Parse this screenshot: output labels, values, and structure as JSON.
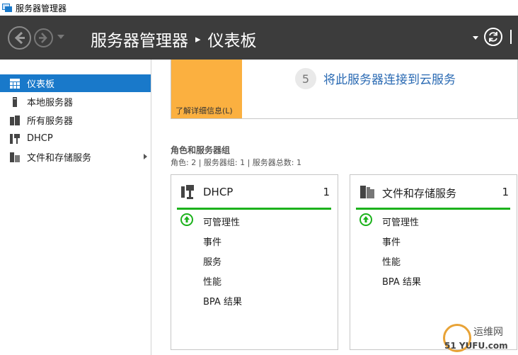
{
  "window": {
    "title": "服务器管理器"
  },
  "header": {
    "breadcrumb_root": "服务器管理器",
    "breadcrumb_separator": "▸",
    "breadcrumb_current": "仪表板"
  },
  "sidebar": {
    "items": [
      {
        "label": "仪表板",
        "icon": "dashboard-icon",
        "active": true
      },
      {
        "label": "本地服务器",
        "icon": "server-icon"
      },
      {
        "label": "所有服务器",
        "icon": "servers-icon"
      },
      {
        "label": "DHCP",
        "icon": "dhcp-icon"
      },
      {
        "label": "文件和存储服务",
        "icon": "file-storage-icon",
        "has_submenu": true
      }
    ]
  },
  "welcome": {
    "learn_more": "了解详细信息(L)",
    "step_number": "5",
    "step_text": "将此服务器连接到云服务"
  },
  "roles": {
    "title": "角色和服务器组",
    "summary": "角色: 2 | 服务器组: 1 | 服务器总数: 1",
    "cards": [
      {
        "title": "DHCP",
        "count": "1",
        "rows": [
          "可管理性",
          "事件",
          "服务",
          "性能",
          "BPA 结果"
        ]
      },
      {
        "title": "文件和存储服务",
        "count": "1",
        "rows": [
          "可管理性",
          "事件",
          "性能",
          "BPA 结果"
        ]
      }
    ]
  },
  "watermark": {
    "line1": "运维网",
    "line2": "51 YUFU.com"
  },
  "colors": {
    "header_bg": "#3c3c3c",
    "active_item": "#1979ca",
    "tile": "#fbb040",
    "status_ok": "#1cb21c",
    "link": "#2a6ab3"
  }
}
